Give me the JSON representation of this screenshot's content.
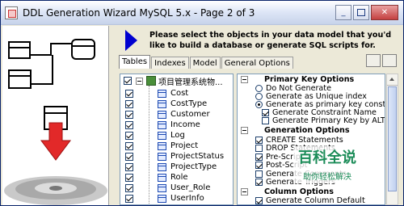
{
  "window": {
    "title": "DDL Generation Wizard MySQL 5.x - Page 2 of 3",
    "controls": [
      "minimize",
      "restore",
      "close"
    ]
  },
  "header": {
    "instruction": "Please select the objects in your data model that you'd like to build a database or generate SQL scripts for."
  },
  "tabs": [
    {
      "label": "Tables",
      "active": true
    },
    {
      "label": "Indexes",
      "active": false
    },
    {
      "label": "Model",
      "active": false
    },
    {
      "label": "General Options",
      "active": false
    }
  ],
  "tables_tree": {
    "root_label": "项目管理系统物...",
    "root_checked": true,
    "items": [
      {
        "label": "Cost",
        "checked": true
      },
      {
        "label": "CostType",
        "checked": true
      },
      {
        "label": "Customer",
        "checked": true
      },
      {
        "label": "Income",
        "checked": true
      },
      {
        "label": "Log",
        "checked": true
      },
      {
        "label": "Project",
        "checked": true
      },
      {
        "label": "ProjectStatus",
        "checked": true
      },
      {
        "label": "ProjectType",
        "checked": true
      },
      {
        "label": "Role",
        "checked": true
      },
      {
        "label": "User_Role",
        "checked": true
      },
      {
        "label": "UserInfo",
        "checked": true
      }
    ]
  },
  "options": {
    "primary_key_group": "Primary Key Options",
    "pk_options": [
      {
        "label": "Do Not Generate",
        "type": "radio",
        "selected": false
      },
      {
        "label": "Generate as Unique index",
        "type": "radio",
        "selected": false
      },
      {
        "label": "Generate as primary key constr...",
        "type": "radio",
        "selected": true
      },
      {
        "label": "Generate Constraint Name",
        "type": "checkbox",
        "checked": true
      },
      {
        "label": "Generate Primary Key by ALT...",
        "type": "checkbox",
        "checked": false
      }
    ],
    "generation_group": "Generation Options",
    "generation_options": [
      {
        "label": "CREATE Statements",
        "checked": true
      },
      {
        "label": "DROP Statements",
        "checked": false
      },
      {
        "label": "Pre-Script",
        "checked": true
      },
      {
        "label": "Post-Script",
        "checked": true
      },
      {
        "label": "Generate Comments",
        "checked": false
      },
      {
        "label": "Generate Triggers",
        "checked": true
      }
    ],
    "column_group": "Column Options",
    "column_options": [
      {
        "label": "Generate Column Default",
        "checked": true
      }
    ]
  },
  "watermark": {
    "title": "百科全说",
    "subtitle": "助你轻松解决"
  }
}
